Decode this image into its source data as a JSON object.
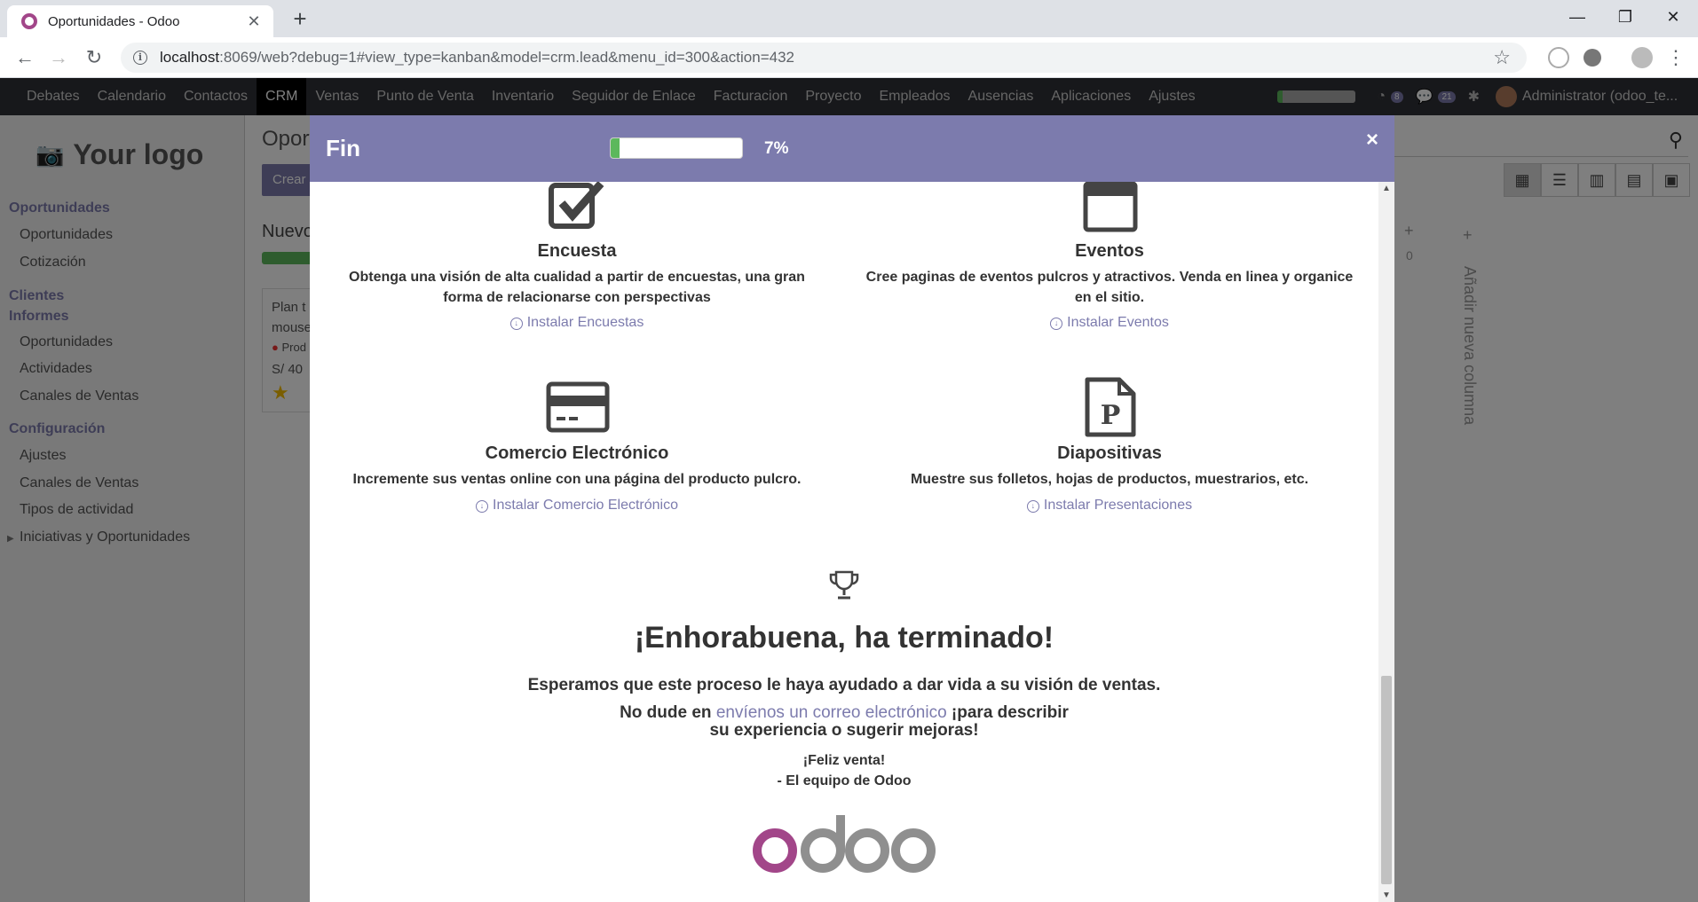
{
  "browser": {
    "tab_title": "Oportunidades - Odoo",
    "url_host": "localhost",
    "url_rest": ":8069/web?debug=1#view_type=kanban&model=crm.lead&menu_id=300&action=432"
  },
  "topmenu": {
    "items": [
      "Debates",
      "Calendario",
      "Contactos",
      "CRM",
      "Ventas",
      "Punto de Venta",
      "Inventario",
      "Seguidor de Enlace",
      "Facturacion",
      "Proyecto",
      "Empleados",
      "Ausencias",
      "Aplicaciones",
      "Ajustes"
    ],
    "active": "CRM",
    "activity_count": "8",
    "message_count": "21",
    "user": "Administrator (odoo_te..."
  },
  "sidebar": {
    "logo_text": "Your logo",
    "sections": [
      {
        "head": "Oportunidades",
        "items": [
          "Oportunidades",
          "Cotización"
        ]
      },
      {
        "head": "Clientes",
        "items": []
      },
      {
        "head": "Informes",
        "items": [
          "Oportunidades",
          "Actividades",
          "Canales de Ventas"
        ]
      },
      {
        "head": "Configuración",
        "items": [
          "Ajustes",
          "Canales de Ventas",
          "Tipos de actividad"
        ]
      }
    ],
    "tree_item": "Iniciativas y Oportunidades"
  },
  "main": {
    "title": "Oport",
    "create_label": "Crear",
    "column_title": "Nuevo",
    "card_line1": "Plan t",
    "card_line2": "mouse",
    "card_tag": "Prod",
    "card_amount": "S/ 40",
    "zero_count": "0",
    "add_column": "Añadir nueva columna"
  },
  "modal": {
    "title": "Fin",
    "progress_percent": 7,
    "progress_label": "7%",
    "apps": [
      {
        "name": "Encuesta",
        "desc": "Obtenga una visión de alta cualidad a partir de encuestas, una gran forma de relacionarse con perspectivas",
        "install": "Instalar Encuestas",
        "icon": "checkbox-icon"
      },
      {
        "name": "Eventos",
        "desc": "Cree paginas de eventos pulcros y atractivos. Venda en linea y organice en el sitio.",
        "install": "Instalar Eventos",
        "icon": "calendar-icon"
      },
      {
        "name": "Comercio Electrónico",
        "desc": "Incremente sus ventas online con una página del producto pulcro.",
        "install": "Instalar Comercio Electrónico",
        "icon": "credit-card-icon"
      },
      {
        "name": "Diapositivas",
        "desc": "Muestre sus folletos, hojas de productos, muestrarios, etc.",
        "install": "Instalar Presentaciones",
        "icon": "slides-file-icon"
      }
    ],
    "congrats_title": "¡Enhorabuena, ha terminado!",
    "congrats_text": "Esperamos que este proceso le haya ayudado a dar vida a su visión de ventas.",
    "feedback_pre": "No dude en ",
    "feedback_link": "envíenos un correo electrónico",
    "feedback_post": " ¡para describir",
    "feedback_line2": "su experiencia o sugerir mejoras!",
    "signoff1": "¡Feliz venta!",
    "signoff2": "- El equipo de Odoo",
    "brand": "odoo"
  },
  "colors": {
    "accent": "#7c7bad",
    "brand_purple": "#a24689",
    "brand_gray": "#8f8f8f",
    "success": "#5cb85c",
    "navbar": "#2f3136"
  }
}
